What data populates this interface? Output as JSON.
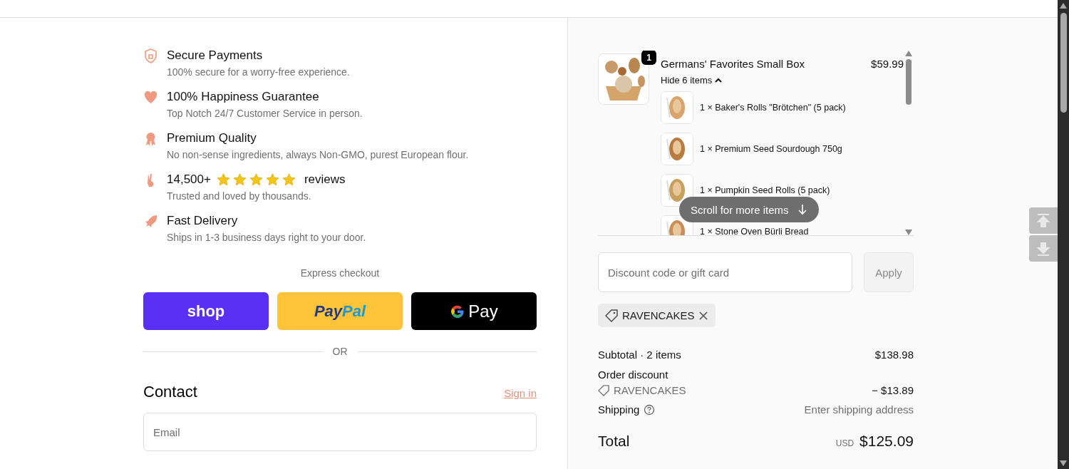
{
  "features": [
    {
      "kind": "shield",
      "title": "Secure Payments",
      "text": "100% secure for a worry-free experience."
    },
    {
      "kind": "heart",
      "title": "100% Happiness Guarantee",
      "text": "Top Notch 24/7 Customer Service in person."
    },
    {
      "kind": "ribbon",
      "title": "Premium Quality",
      "text": "No non-sense ingredients, always Non-GMO, purest European flour."
    },
    {
      "kind": "hand",
      "title": "14,500+",
      "stars": 5,
      "suffix": "reviews",
      "text": "Trusted and loved by thousands."
    },
    {
      "kind": "rocket",
      "title": "Fast Delivery",
      "text": "Ships in 1-3 business days right to your door."
    }
  ],
  "express": {
    "label": "Express checkout",
    "buttons": [
      {
        "kind": "shop",
        "label": "shop"
      },
      {
        "kind": "paypal",
        "label": "Pay",
        "label2": "Pal"
      },
      {
        "kind": "gpay",
        "label": "Pay"
      }
    ],
    "divider": "OR"
  },
  "contact": {
    "title": "Contact",
    "link": "Sign in",
    "email": {
      "placeholder": "Email"
    }
  },
  "cart": {
    "product": {
      "name": "Germans' Favorites Small Box",
      "price": "$59.99",
      "quantity": "1",
      "toggle": "Hide 6 items",
      "expanded": true,
      "items": [
        "1 × Baker's Rolls \"Brötchen\" (5 pack)",
        "1 × Premium Seed Sourdough 750g",
        "1 × Pumpkin Seed Rolls (5 pack)",
        "1 × Stone Oven Bürli Bread"
      ]
    },
    "scroll_hint": "Scroll for more items"
  },
  "discount": {
    "placeholder": "Discount code or gift card",
    "button": "Apply",
    "applied": "RAVENCAKES"
  },
  "summary": {
    "subtotal": {
      "label": "Subtotal · 2 items",
      "value": "$138.98"
    },
    "order_discount": "Order discount",
    "code": "RAVENCAKES",
    "discount": "− $13.89",
    "shipping": {
      "label": "Shipping",
      "value": "Enter shipping address"
    },
    "total": {
      "label": "Total",
      "currency": "USD",
      "value": "$125.09"
    }
  }
}
